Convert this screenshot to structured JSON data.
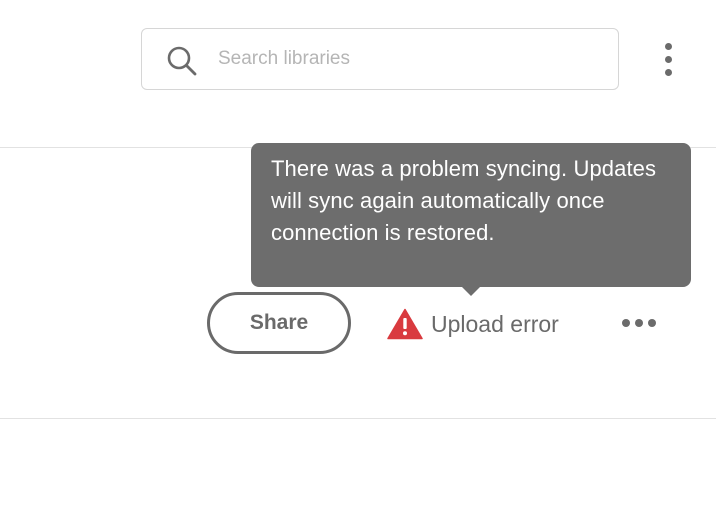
{
  "search": {
    "placeholder": "Search libraries",
    "value": "",
    "icon": "search-icon"
  },
  "header_menu": {
    "icon": "vertical-dots-icon"
  },
  "tooltip": {
    "text": "There was a problem syncing. Updates will sync again automatically once connection is restored."
  },
  "actions": {
    "share_label": "Share",
    "upload_status": {
      "label": "Upload error",
      "icon": "warning-icon",
      "icon_color": "#d93a3f"
    },
    "more_icon": "more-horizontal-icon"
  },
  "colors": {
    "tooltip_bg": "#6d6d6d",
    "text_gray": "#6a6a6a",
    "divider": "#e2e2e2",
    "error_red": "#d93a3f"
  }
}
